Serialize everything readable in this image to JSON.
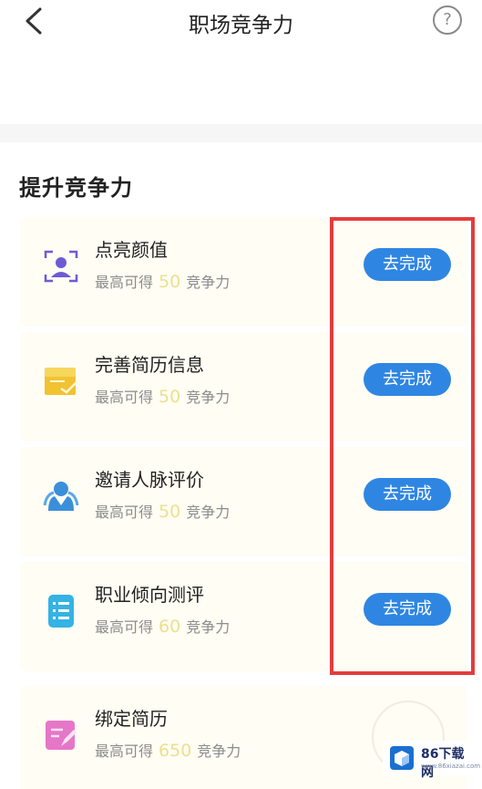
{
  "header": {
    "title": "职场竞争力",
    "back_icon": "chevron-left-icon",
    "help_label": "?"
  },
  "section": {
    "title": "提升竞争力"
  },
  "tasks": [
    {
      "name": "点亮颜值",
      "reward_prefix": "最高可得",
      "points": "50",
      "reward_suffix": "竞争力",
      "button": "去完成",
      "icon": "portrait-icon"
    },
    {
      "name": "完善简历信息",
      "reward_prefix": "最高可得",
      "points": "50",
      "reward_suffix": "竞争力",
      "button": "去完成",
      "icon": "resume-edit-icon"
    },
    {
      "name": "邀请人脉评价",
      "reward_prefix": "最高可得",
      "points": "50",
      "reward_suffix": "竞争力",
      "button": "去完成",
      "icon": "people-icon"
    },
    {
      "name": "职业倾向测评",
      "reward_prefix": "最高可得",
      "points": "60",
      "reward_suffix": "竞争力",
      "button": "去完成",
      "icon": "list-icon"
    },
    {
      "name": "绑定简历",
      "reward_prefix": "最高可得",
      "points": "650",
      "reward_suffix": "竞争力",
      "icon": "bind-resume-icon"
    }
  ],
  "watermark": {
    "name": "86下载网",
    "sub": "www.86xiazai.com"
  },
  "colors": {
    "accent": "#2f86e2",
    "highlight": "#e53c3c",
    "points": "#ece08e"
  }
}
